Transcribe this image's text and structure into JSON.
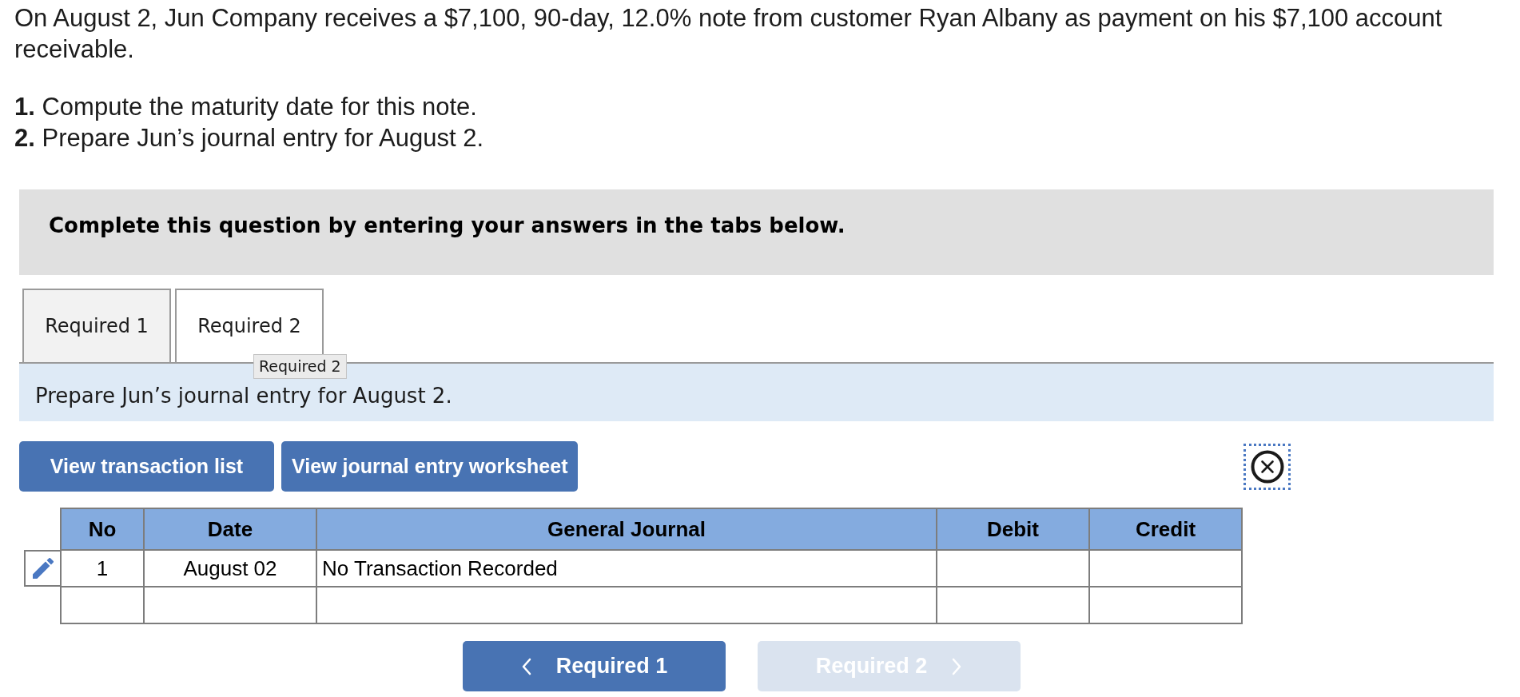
{
  "problem": {
    "intro": "On August 2, Jun Company receives a $7,100, 90-day, 12.0% note from customer Ryan Albany as payment on his $7,100 account receivable.",
    "tasks": [
      "**1.** Compute the maturity date for this note.",
      "**2.** Prepare Jun’s journal entry for August 2."
    ]
  },
  "instructions_banner": "Complete this question by entering your answers in the tabs below.",
  "tabs": [
    {
      "label": "Required 1",
      "selected": false
    },
    {
      "label": "Required 2",
      "selected": true
    }
  ],
  "tooltip": "Required 2",
  "tab_prompt": "Prepare Jun’s journal entry for August 2.",
  "action_buttons": [
    "View transaction list",
    "View journal entry worksheet"
  ],
  "journal": {
    "columns": [
      "No",
      "Date",
      "General Journal",
      "Debit",
      "Credit"
    ],
    "rows": [
      {
        "editable": true,
        "cells": [
          "1",
          "August 02",
          "No Transaction Recorded"
        ]
      },
      {
        "editable": false
      }
    ]
  },
  "nav_buttons": [
    {
      "label": "Required 1",
      "kind": "back",
      "disabled": false
    },
    {
      "label": "Required 2",
      "kind": "next",
      "disabled": true
    }
  ]
}
